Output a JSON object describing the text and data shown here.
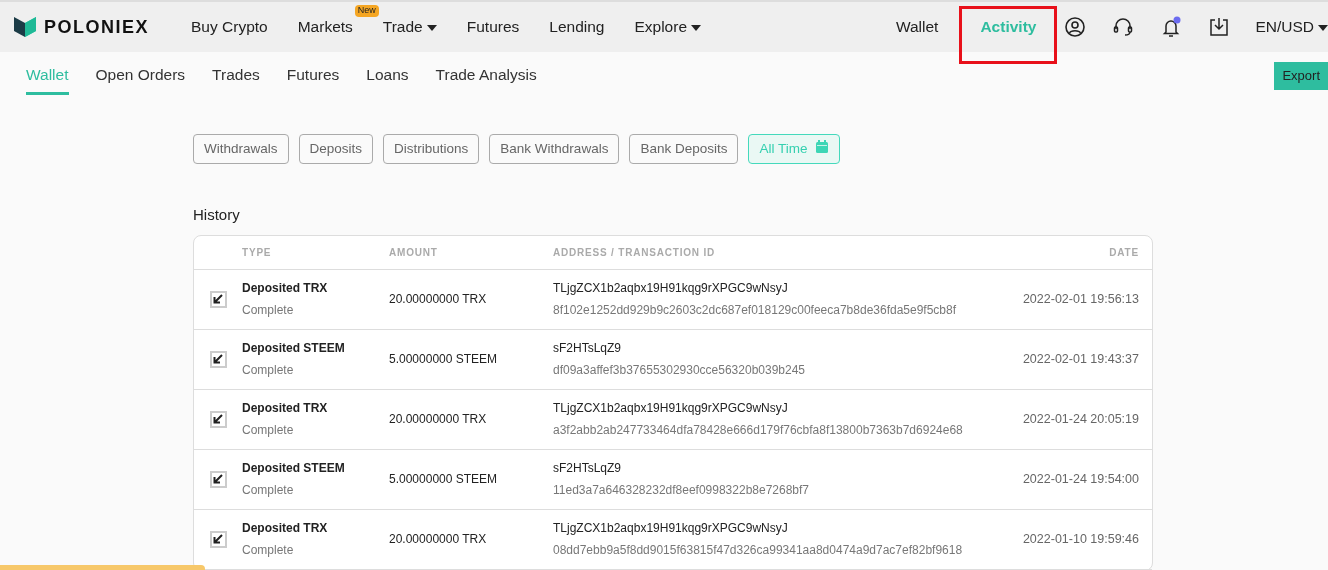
{
  "brand": {
    "name": "POLONIEX"
  },
  "nav": [
    {
      "label": "Buy Crypto",
      "caret": false
    },
    {
      "label": "Markets",
      "caret": false,
      "badge": "New"
    },
    {
      "label": "Trade",
      "caret": true
    },
    {
      "label": "Futures",
      "caret": false
    },
    {
      "label": "Lending",
      "caret": false
    },
    {
      "label": "Explore",
      "caret": true
    }
  ],
  "nav_right": [
    {
      "label": "Wallet",
      "selected": false,
      "highlighted": false
    },
    {
      "label": "Activity",
      "selected": true,
      "highlighted": true
    }
  ],
  "header_icons": [
    {
      "kind": "account"
    },
    {
      "kind": "support"
    },
    {
      "kind": "bell",
      "dot": true
    },
    {
      "kind": "download"
    }
  ],
  "locale": {
    "label": "EN/USD",
    "caret": true
  },
  "subtabs": [
    {
      "label": "Wallet",
      "selected": true
    },
    {
      "label": "Open Orders",
      "selected": false
    },
    {
      "label": "Trades",
      "selected": false
    },
    {
      "label": "Futures",
      "selected": false
    },
    {
      "label": "Loans",
      "selected": false
    },
    {
      "label": "Trade Analysis",
      "selected": false
    }
  ],
  "export_button": "Export",
  "filters": [
    {
      "label": "Withdrawals",
      "selected": false
    },
    {
      "label": "Deposits",
      "selected": false
    },
    {
      "label": "Distributions",
      "selected": false
    },
    {
      "label": "Bank Withdrawals",
      "selected": false
    },
    {
      "label": "Bank Deposits",
      "selected": false
    },
    {
      "label": "All Time",
      "selected": true,
      "calendar": true
    }
  ],
  "history": {
    "title": "History",
    "columns": [
      "TYPE",
      "AMOUNT",
      "ADDRESS / TRANSACTION ID",
      "DATE"
    ],
    "rows": [
      {
        "type": "Deposited TRX",
        "status": "Complete",
        "amount": "20.00000000 TRX",
        "address": "TLjgZCX1b2aqbx19H91kqg9rXPGC9wNsyJ",
        "txid": "8f102e1252dd929b9c2603c2dc687ef018129c00feeca7b8de36fda5e9f5cb8f",
        "date": "2022-02-01 19:56:13"
      },
      {
        "type": "Deposited STEEM",
        "status": "Complete",
        "amount": "5.00000000 STEEM",
        "address": "sF2HTsLqZ9",
        "txid": "df09a3affef3b37655302930cce56320b039b245",
        "date": "2022-02-01 19:43:37"
      },
      {
        "type": "Deposited TRX",
        "status": "Complete",
        "amount": "20.00000000 TRX",
        "address": "TLjgZCX1b2aqbx19H91kqg9rXPGC9wNsyJ",
        "txid": "a3f2abb2ab247733464dfa78428e666d179f76cbfa8f13800b7363b7d6924e68",
        "date": "2022-01-24 20:05:19"
      },
      {
        "type": "Deposited STEEM",
        "status": "Complete",
        "amount": "5.00000000 STEEM",
        "address": "sF2HTsLqZ9",
        "txid": "11ed3a7a646328232df8eef0998322b8e7268bf7",
        "date": "2022-01-24 19:54:00"
      },
      {
        "type": "Deposited TRX",
        "status": "Complete",
        "amount": "20.00000000 TRX",
        "address": "TLjgZCX1b2aqbx19H91kqg9rXPGC9wNsyJ",
        "txid": "08dd7ebb9a5f8dd9015f63815f47d326ca99341aa8d0474a9d7ac7ef82bf9618",
        "date": "2022-01-10 19:59:46"
      }
    ]
  }
}
